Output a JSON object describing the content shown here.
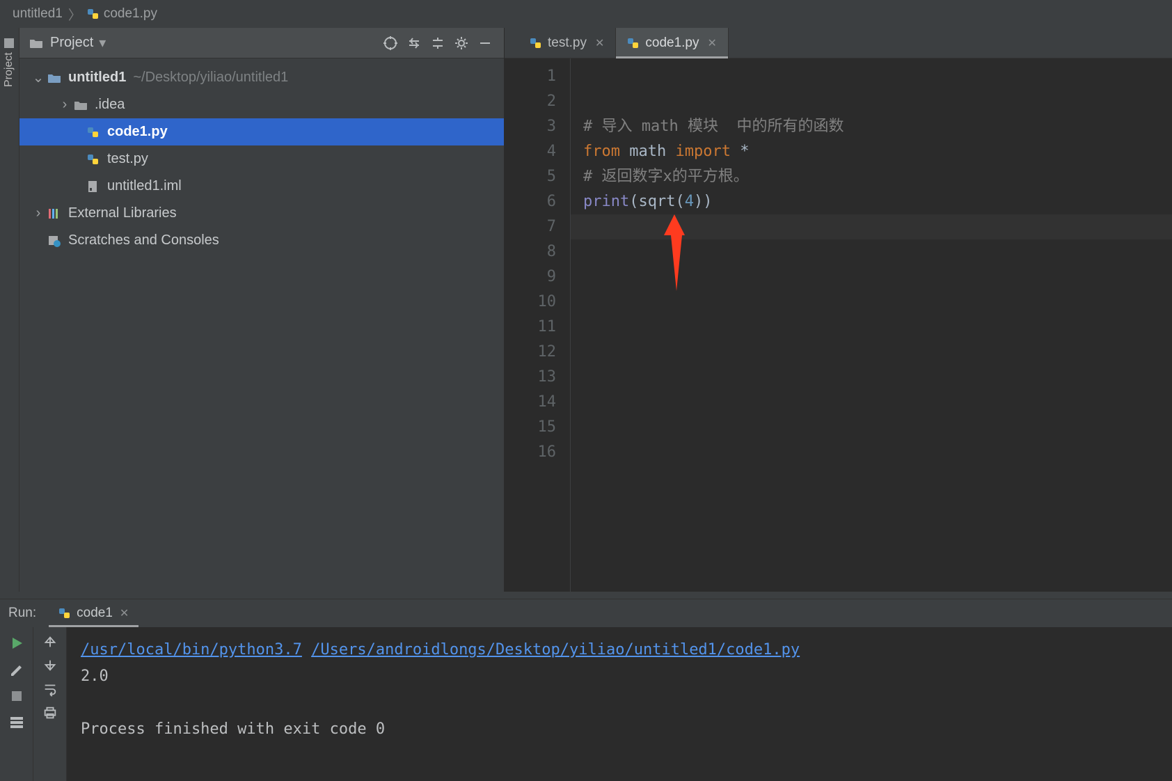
{
  "breadcrumb": {
    "project": "untitled1",
    "file": "code1.py"
  },
  "project_pane": {
    "title": "Project",
    "root": {
      "name": "untitled1",
      "path": "~/Desktop/yiliao/untitled1"
    },
    "items": [
      {
        "name": ".idea"
      },
      {
        "name": "code1.py"
      },
      {
        "name": "test.py"
      },
      {
        "name": "untitled1.iml"
      }
    ],
    "ext_libs": "External Libraries",
    "scratches": "Scratches and Consoles"
  },
  "editor": {
    "tabs": [
      {
        "label": "test.py"
      },
      {
        "label": "code1.py"
      }
    ],
    "line_numbers": [
      "1",
      "2",
      "3",
      "4",
      "5",
      "6",
      "7",
      "8",
      "9",
      "10",
      "11",
      "12",
      "13",
      "14",
      "15",
      "16"
    ],
    "code": {
      "l3_comment": "# 导入 math 模块  中的所有的函数",
      "l4_from": "from ",
      "l4_math": "math ",
      "l4_import": "import ",
      "l4_star": "*",
      "l5_comment": "# 返回数字x的平方根。",
      "l6_print": "print",
      "l6_open": "(",
      "l6_sqrt": "sqrt",
      "l6_p2": "(",
      "l6_num": "4",
      "l6_close": "))"
    }
  },
  "run": {
    "label": "Run:",
    "tab": "code1",
    "cmd_python": "/usr/local/bin/python3.7",
    "cmd_file": "/Users/androidlongs/Desktop/yiliao/untitled1/code1.py",
    "output": "2.0",
    "exit": "Process finished with exit code 0"
  }
}
